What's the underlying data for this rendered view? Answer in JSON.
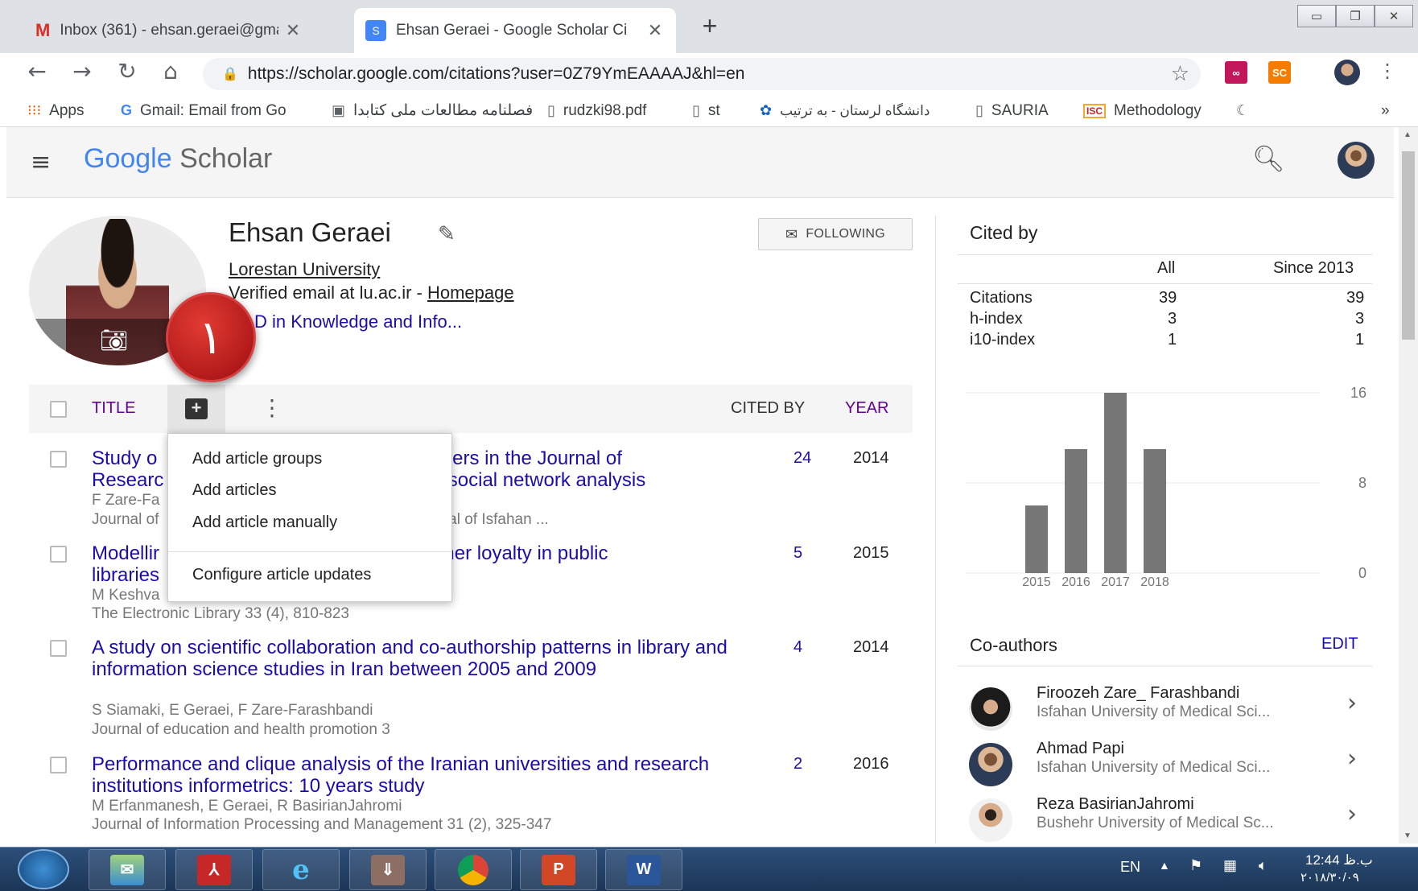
{
  "browser": {
    "tabs": [
      {
        "label": "Inbox (361) - ehsan.geraei@gma",
        "icon": "gmail-icon"
      },
      {
        "label": "Ehsan Geraei - Google Scholar Ci",
        "icon": "scholar-icon"
      }
    ],
    "new_tab": "+",
    "url": "https://scholar.google.com/citations?user=0Z79YmEAAAAJ&hl=en",
    "bookmarks": [
      "Apps",
      "Gmail: Email from Go",
      "فصلنامه مطالعات ملی کتابدا",
      "rudzki98.pdf",
      "st",
      "دانشگاه لرستان - به ترتیب",
      "SAURIA",
      "Methodology"
    ],
    "bookmarks_more": "»",
    "ext_labels": [
      "SC",
      "ISC"
    ]
  },
  "scholar": {
    "logo_google": "Google",
    "logo_scholar": "Scholar"
  },
  "profile": {
    "name": "Ehsan Geraei",
    "affiliation": "Lorestan University",
    "email_text": "Verified email at lu.ac.ir - ",
    "homepage": "Homepage",
    "interest": "PhD in Knowledge and Info...",
    "interest_visible": "D in Knowledge and Info...",
    "follow_label": "FOLLOWING"
  },
  "marker": {
    "label": "۱",
    "color": "#c62828"
  },
  "table": {
    "title_header": "TITLE",
    "cited_header": "CITED BY",
    "year_header": "YEAR",
    "rows": [
      {
        "title": "Study o                                                     pers in the Journal of",
        "title2": "Researc                                                     social network analysis",
        "authors": "F Zare-Fa",
        "venue": "Journal of                                                   fficial journal of Isfahan ...",
        "cited": "24",
        "year": "2014"
      },
      {
        "title": "Modellir                                                    mer loyalty in public",
        "title2": "libraries",
        "authors": "M Keshva",
        "venue": "The Electronic Library 33 (4), 810-823",
        "cited": "5",
        "year": "2015"
      },
      {
        "title": "A study on scientific collaboration and co-authorship patterns in library and information science studies in Iran between 2005 and 2009",
        "authors": "S Siamaki, E Geraei, F Zare-Farashbandi",
        "venue": "Journal of education and health promotion 3",
        "cited": "4",
        "year": "2014"
      },
      {
        "title": "Performance and clique analysis of the Iranian universities and research institutions informetrics: 10 years study",
        "authors": "M Erfanmanesh, E Geraei, R BasirianJahromi",
        "venue": "Journal of Information Processing and Management 31 (2), 325-347",
        "cited": "2",
        "year": "2016"
      }
    ]
  },
  "dropdown": {
    "items": [
      "Add article groups",
      "Add articles",
      "Add article manually",
      "Configure article updates"
    ]
  },
  "cited_by": {
    "title": "Cited by",
    "col_all": "All",
    "col_since": "Since 2013",
    "rows": [
      {
        "label": "Citations",
        "all": "39",
        "since": "39"
      },
      {
        "label": "h-index",
        "all": "3",
        "since": "3"
      },
      {
        "label": "i10-index",
        "all": "1",
        "since": "1"
      }
    ]
  },
  "chart_data": {
    "type": "bar",
    "categories": [
      "2015",
      "2016",
      "2017",
      "2018"
    ],
    "values": [
      6,
      11,
      16,
      11
    ],
    "ylim": [
      0,
      16
    ],
    "yticks": [
      "16",
      "8",
      "0"
    ],
    "bar_color": "#777777"
  },
  "coauthors": {
    "title": "Co-authors",
    "edit": "EDIT",
    "items": [
      {
        "name": "Firoozeh Zare_ Farashbandi",
        "inst": "Isfahan University of Medical Sci..."
      },
      {
        "name": "Ahmad Papi",
        "inst": "Isfahan University of Medical Sci..."
      },
      {
        "name": "Reza BasirianJahromi",
        "inst": "Bushehr University of Medical Sc..."
      }
    ]
  },
  "taskbar": {
    "lang": "EN",
    "time": "12:44 ب.ظ",
    "date": "۲۰۱۸/۳۰/۰۹"
  }
}
